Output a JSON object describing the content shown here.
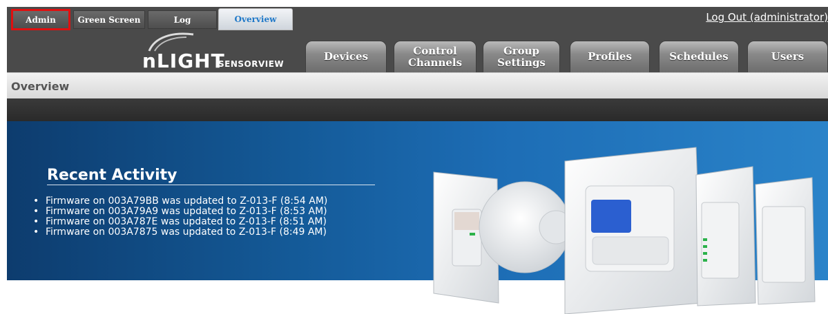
{
  "topbar": {
    "tabs": [
      {
        "label": "Admin"
      },
      {
        "label": "Green Screen"
      },
      {
        "label": "Log"
      },
      {
        "label": "Overview"
      }
    ],
    "logout_label": "Log Out (administrator)"
  },
  "logo": {
    "main": "nLIGHT",
    "sub": "SENSORVIEW"
  },
  "nav": [
    {
      "label": "Devices"
    },
    {
      "label": "Control\nChannels"
    },
    {
      "label": "Group\nSettings"
    },
    {
      "label": "Profiles"
    },
    {
      "label": "Schedules"
    },
    {
      "label": "Users"
    }
  ],
  "page_title": "Overview",
  "hero": {
    "title": "Recent Activity",
    "items": [
      "Firmware on 003A79BB was updated to Z-013-F (8:54 AM)",
      "Firmware on 003A79A9 was updated to Z-013-F (8:53 AM)",
      "Firmware on 003A787E was updated to Z-013-F (8:51 AM)",
      "Firmware on 003A7875 was updated to Z-013-F (8:49 AM)"
    ]
  },
  "colors": {
    "selected_tab_text": "#1f78c8",
    "highlight_outline": "#e01010"
  }
}
